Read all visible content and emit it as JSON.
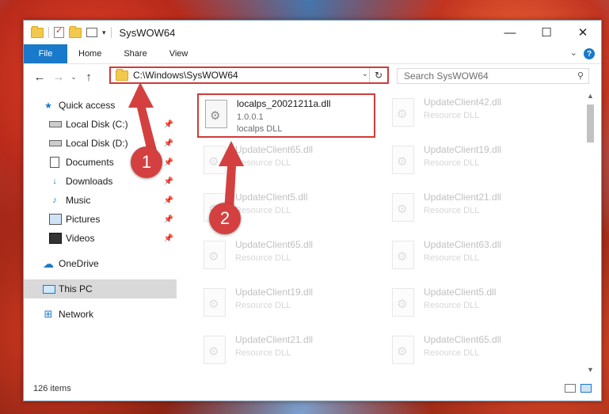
{
  "window": {
    "title": "SysWOW64",
    "controls": {
      "minimize": "—",
      "maximize": "☐",
      "close": "✕"
    }
  },
  "ribbon": {
    "file_label": "File",
    "tabs": [
      "Home",
      "Share",
      "View"
    ],
    "help": "?"
  },
  "navigation": {
    "back": "←",
    "forward": "→",
    "recent": "⌄",
    "up": "↑",
    "address": "C:\\Windows\\SysWOW64",
    "search_placeholder": "Search SysWOW64"
  },
  "sidebar": {
    "items": [
      {
        "label": "Quick access",
        "icon": "star-icon",
        "pinned": false
      },
      {
        "label": "Local Disk (C:)",
        "icon": "disk-icon",
        "pinned": true
      },
      {
        "label": "Local Disk (D:)",
        "icon": "disk-icon",
        "pinned": true
      },
      {
        "label": "Documents",
        "icon": "document-icon",
        "pinned": true
      },
      {
        "label": "Downloads",
        "icon": "download-icon",
        "pinned": true
      },
      {
        "label": "Music",
        "icon": "music-icon",
        "pinned": true
      },
      {
        "label": "Pictures",
        "icon": "picture-icon",
        "pinned": true
      },
      {
        "label": "Videos",
        "icon": "video-icon",
        "pinned": true
      },
      {
        "label": "OneDrive",
        "icon": "cloud-icon",
        "pinned": false
      },
      {
        "label": "This PC",
        "icon": "computer-icon",
        "pinned": false
      },
      {
        "label": "Network",
        "icon": "network-icon",
        "pinned": false
      }
    ],
    "selected": "This PC"
  },
  "files": [
    {
      "name": "localps_20021211a.dll",
      "version": "1.0.0.1",
      "description": "localps DLL",
      "highlighted": true
    },
    {
      "name": "UpdateClient42.dll",
      "description": "Resource DLL"
    },
    {
      "name": "UpdateClient65.dll",
      "description": "Resource DLL"
    },
    {
      "name": "UpdateClient19.dll",
      "description": "Resource DLL"
    },
    {
      "name": "UpdateClient5.dll",
      "description": "Resource DLL"
    },
    {
      "name": "UpdateClient21.dll",
      "description": "Resource DLL"
    },
    {
      "name": "UpdateClient65.dll",
      "description": "Resource DLL"
    },
    {
      "name": "UpdateClient63.dll",
      "description": "Resource DLL"
    },
    {
      "name": "UpdateClient19.dll",
      "description": "Resource DLL"
    },
    {
      "name": "UpdateClient5.dll",
      "description": "Resource DLL"
    },
    {
      "name": "UpdateClient21.dll",
      "description": "Resource DLL"
    },
    {
      "name": "UpdateClient65.dll",
      "description": "Resource DLL"
    }
  ],
  "status": {
    "item_count": "126 items"
  },
  "callouts": [
    {
      "number": "1"
    },
    {
      "number": "2"
    }
  ],
  "colors": {
    "accent": "#1979ca",
    "highlight": "#d03a3a",
    "callout": "#d44040"
  }
}
